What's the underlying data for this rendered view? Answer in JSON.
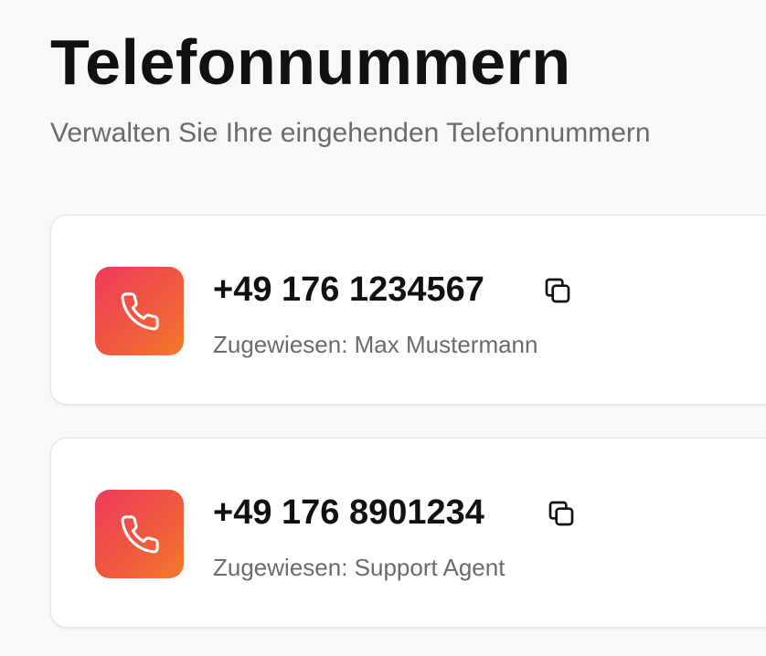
{
  "header": {
    "title": "Telefonnummern",
    "subtitle": "Verwalten Sie Ihre eingehenden Telefonnummern"
  },
  "numbers": [
    {
      "number": "+49 176 1234567",
      "assigned": "Zugewiesen: Max Mustermann"
    },
    {
      "number": "+49 176 8901234",
      "assigned": "Zugewiesen: Support Agent"
    }
  ],
  "icons": {
    "phone": "phone-icon",
    "copy": "copy-icon"
  },
  "colors": {
    "accent_gradient_start": "#ee3a5b",
    "accent_gradient_end": "#f27a2a",
    "title": "#111111",
    "muted_text": "#6b6b6b",
    "background": "#f7f8f8",
    "card": "#ffffff"
  }
}
